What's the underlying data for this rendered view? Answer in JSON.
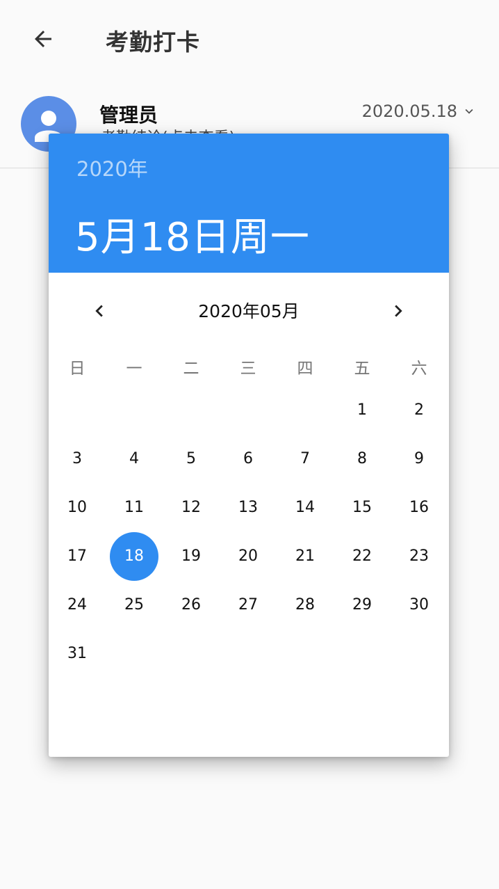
{
  "header": {
    "title": "考勤打卡",
    "back_icon": "arrow-left-icon"
  },
  "user": {
    "name": "管理员",
    "subtitle": "考勤结论(点击查看)",
    "date": "2020.05.18",
    "avatar_icon": "person-icon"
  },
  "picker": {
    "year": "2020年",
    "selected_date": "5月18日周一",
    "month_label": "2020年05月",
    "accent": "#2f8cf1",
    "weekdays": [
      "日",
      "一",
      "二",
      "三",
      "四",
      "五",
      "六"
    ],
    "weeks": [
      [
        "",
        "",
        "",
        "",
        "",
        "1",
        "2"
      ],
      [
        "3",
        "4",
        "5",
        "6",
        "7",
        "8",
        "9"
      ],
      [
        "10",
        "11",
        "12",
        "13",
        "14",
        "15",
        "16"
      ],
      [
        "17",
        "18",
        "19",
        "20",
        "21",
        "22",
        "23"
      ],
      [
        "24",
        "25",
        "26",
        "27",
        "28",
        "29",
        "30"
      ],
      [
        "31",
        "",
        "",
        "",
        "",
        "",
        ""
      ]
    ],
    "selected_day": "18"
  }
}
